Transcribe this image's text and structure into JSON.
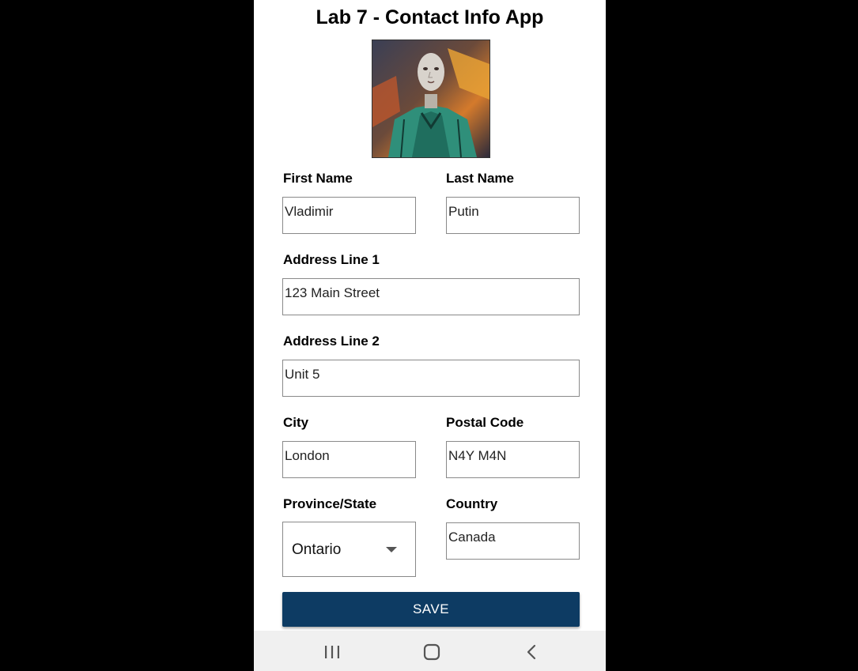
{
  "app": {
    "title": "Lab 7 - Contact Info App"
  },
  "form": {
    "first_name": {
      "label": "First Name",
      "value": "Vladimir"
    },
    "last_name": {
      "label": "Last Name",
      "value": "Putin"
    },
    "address_line_1": {
      "label": "Address Line 1",
      "value": "123 Main Street"
    },
    "address_line_2": {
      "label": "Address Line 2",
      "value": "Unit 5"
    },
    "city": {
      "label": "City",
      "value": "London"
    },
    "postal_code": {
      "label": "Postal Code",
      "value": "N4Y M4N"
    },
    "province_state": {
      "label": "Province/State",
      "selected": "Ontario"
    },
    "country": {
      "label": "Country",
      "value": "Canada"
    },
    "save_label": "SAVE"
  },
  "nav": {
    "icons": [
      "recent-apps-icon",
      "home-icon",
      "back-icon"
    ]
  },
  "colors": {
    "save_button": "#0d3b63",
    "nav_bar": "#f0f0f0",
    "background": "#000000"
  }
}
